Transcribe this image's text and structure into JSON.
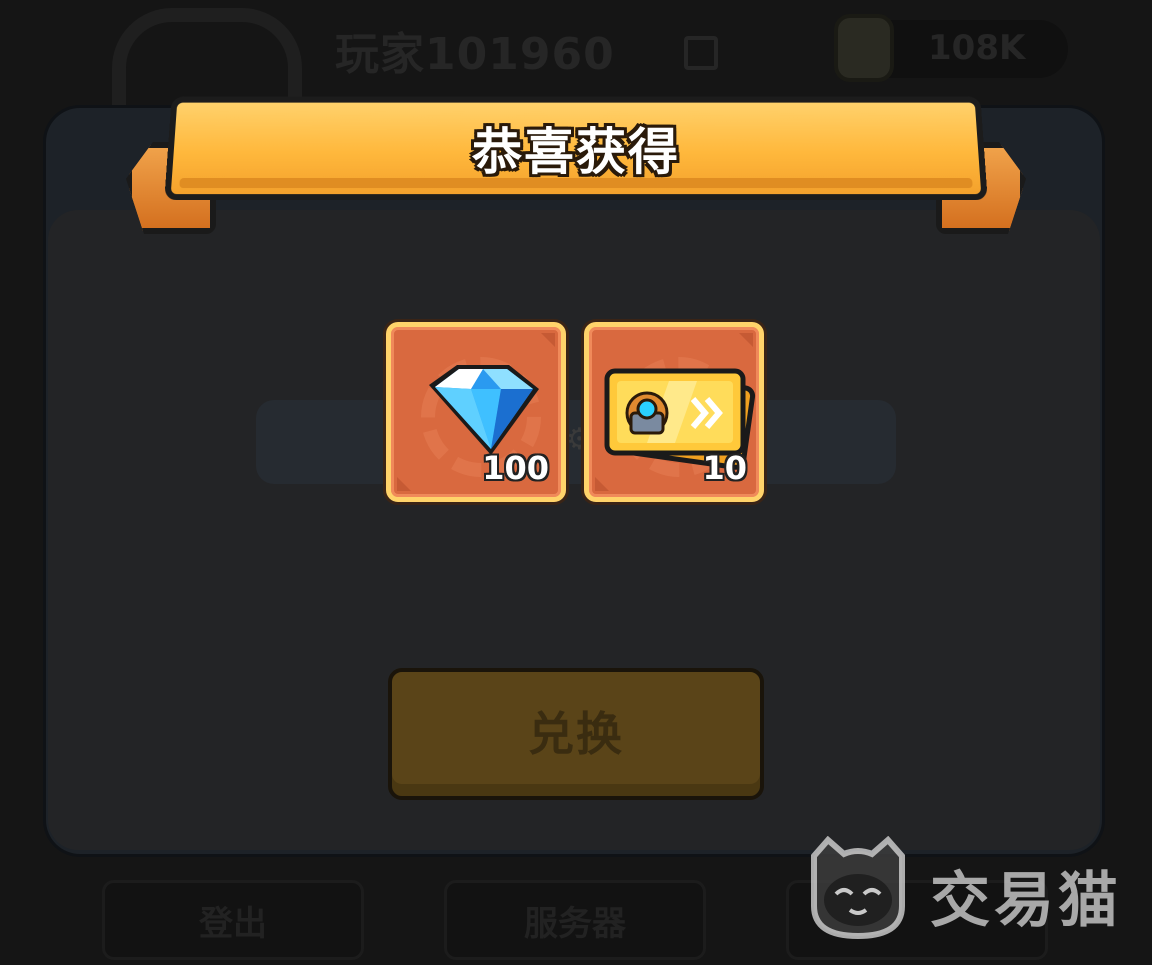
{
  "background": {
    "player_name": "玩家101960",
    "power_value": "108K",
    "bottom_buttons": [
      "登出",
      "服务器",
      ""
    ]
  },
  "dialog": {
    "title": "恭喜获得",
    "rewards": [
      {
        "name": "diamond",
        "quantity": "100",
        "icon": "blue-diamond-icon"
      },
      {
        "name": "ticket",
        "quantity": "10",
        "icon": "mech-ticket-icon"
      }
    ],
    "exchange_button": "兑换"
  },
  "watermark": {
    "text": "交易猫",
    "icon": "cat-logo-icon"
  },
  "colors": {
    "ribbon": "#ffb83c",
    "item_bg": "#d9693f",
    "item_border": "#ffd36a",
    "button_dim": "#5a4418"
  }
}
